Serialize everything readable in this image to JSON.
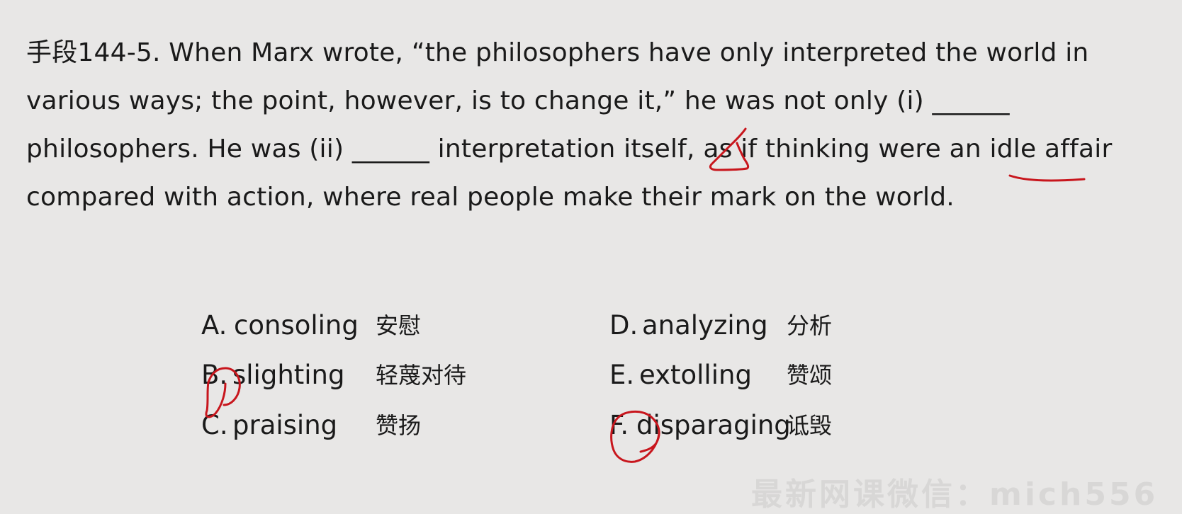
{
  "question": {
    "line1": "手段144-5. When Marx wrote, “the philosophers have only interpreted the world in",
    "line2": "various ways; the point, however, is to change it,” he was not only (i) ______",
    "line3": "philosophers. He was (ii) ______ interpretation itself, as if thinking were an idle affair",
    "line4": "compared with action, where real people make their mark on the world."
  },
  "options": [
    {
      "letter": "A.",
      "word": "consoling",
      "cn": "安慰"
    },
    {
      "letter": "B.",
      "word": "slighting",
      "cn": "轻蔑对待"
    },
    {
      "letter": "C.",
      "word": "praising",
      "cn": "赞扬"
    },
    {
      "letter": "D.",
      "word": "analyzing",
      "cn": "分析"
    },
    {
      "letter": "E.",
      "word": "extolling",
      "cn": "赞颂"
    },
    {
      "letter": "F.",
      "word": "disparaging",
      "cn": "诋毁"
    }
  ],
  "watermark": "最新网课微信：mich556",
  "colors": {
    "background": "#e8e7e6",
    "text": "#1a1a1a",
    "annotation": "#c8161d"
  }
}
